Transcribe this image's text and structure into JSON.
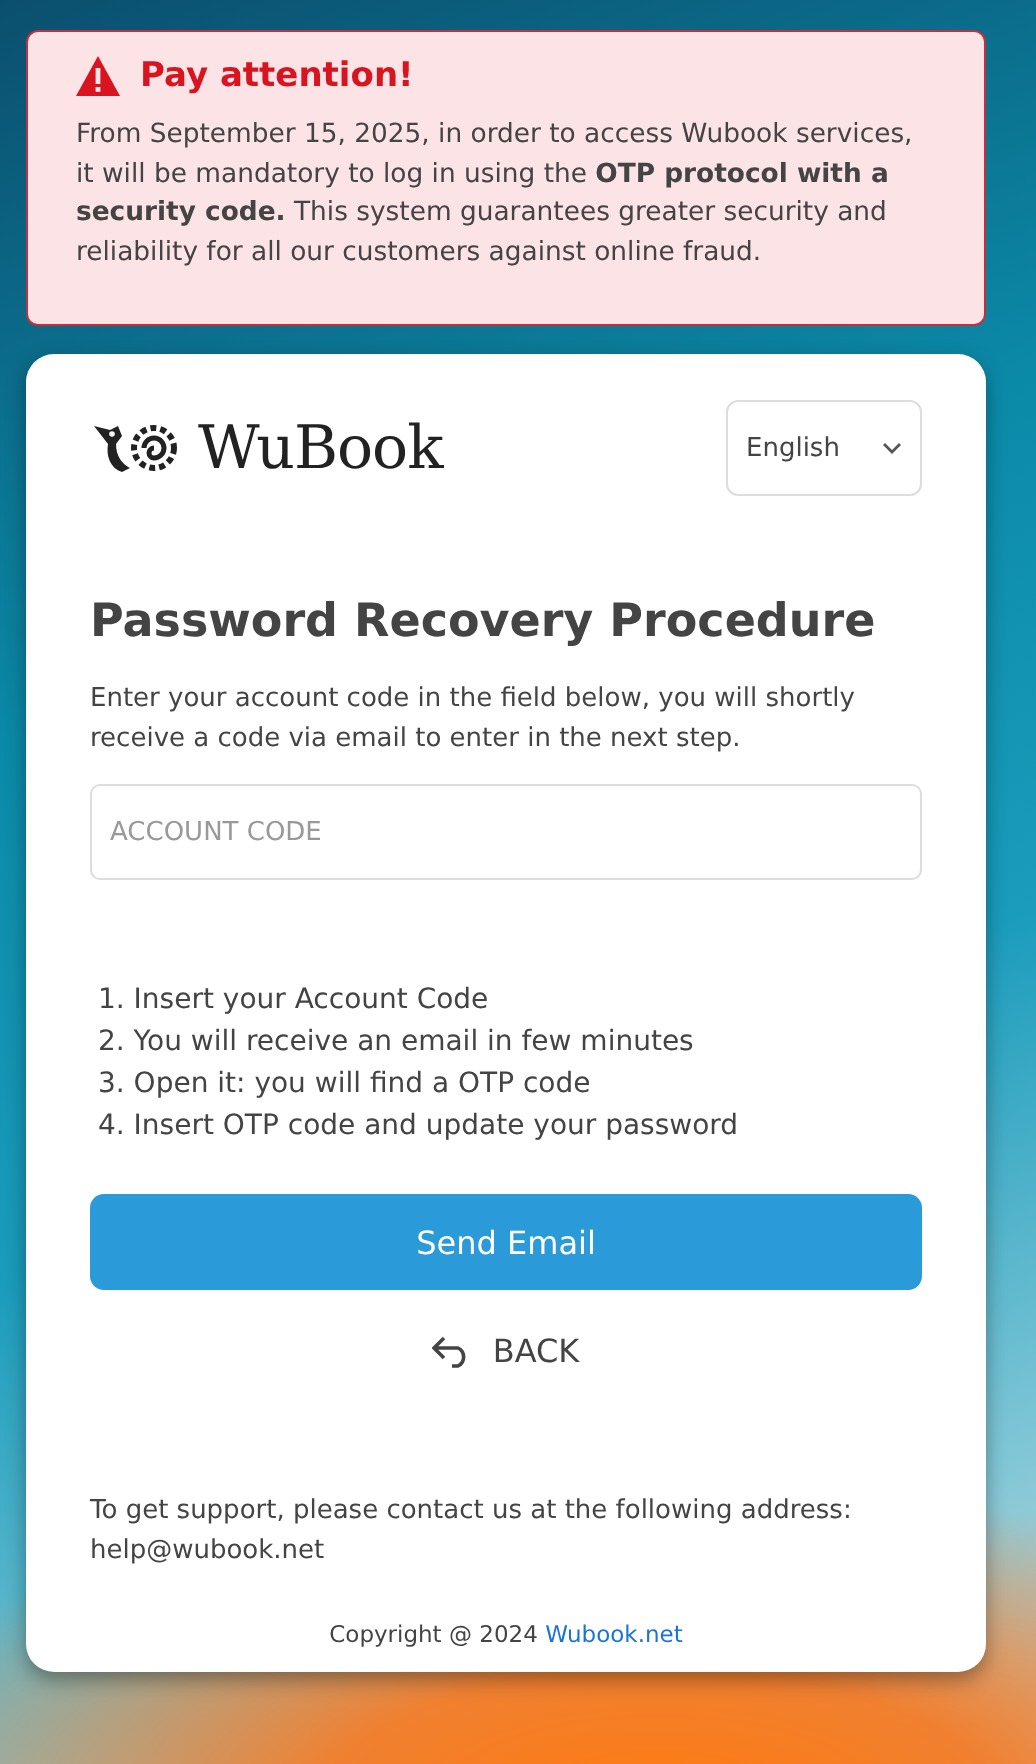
{
  "alert": {
    "title": "Pay attention!",
    "text": "From September 15, 2025, in order to access Wubook services, it will be mandatory to log in using the **OTP protocol with a security code.** This system guarantees greater security and reliability for all our customers against online fraud."
  },
  "card": {
    "logo": "WuBook",
    "language": "English",
    "title": "Password Recovery Procedure",
    "intro": "Enter your account code in the field below, you will shortly receive a code via email to enter in the next step.",
    "field": {
      "placeholder": "ACCOUNT CODE"
    },
    "steps": [
      "1. Insert your Account Code",
      "2. You will receive an email in few minutes",
      "3. Open it: you will find a OTP code",
      "4. Insert OTP code and update your password"
    ],
    "button": "Send Email",
    "back": "BACK",
    "support": "To get support, please contact us at the following address: help@wubook.net",
    "copyright": "Copyright @ 2024",
    "copyright_link": "Wubook.net"
  }
}
